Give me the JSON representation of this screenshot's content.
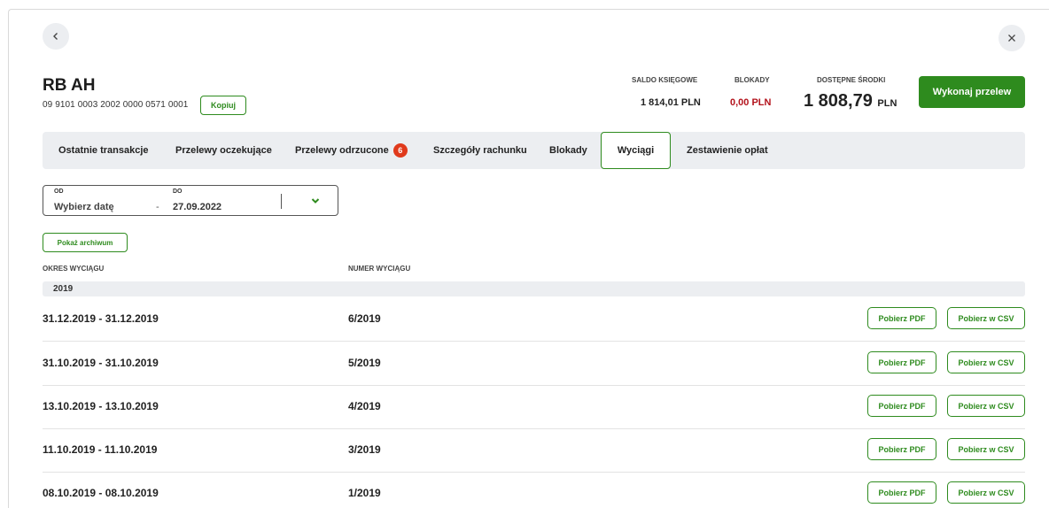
{
  "nav": {
    "back_icon": "chevron-left-icon",
    "close_icon": "close-icon"
  },
  "account": {
    "name": "RB AH",
    "number": "09 9101 0003 2002 0000 0571 0001",
    "copy_label": "Kopiuj"
  },
  "balances": {
    "saldo_label": "SALDO KSIĘGOWE",
    "saldo_value": "1 814,01 PLN",
    "blokady_label": "BLOKADY",
    "blokady_value": "0,00 PLN",
    "dostepne_label": "DOSTĘPNE ŚRODKI",
    "dostepne_value": "1 808,79",
    "dostepne_currency": "PLN"
  },
  "transfer_button": "Wykonaj przelew",
  "tabs": [
    {
      "label": "Ostatnie transakcje"
    },
    {
      "label": "Przelewy oczekujące"
    },
    {
      "label": "Przelewy odrzucone",
      "badge": "6"
    },
    {
      "label": "Szczegóły rachunku"
    },
    {
      "label": "Blokady"
    },
    {
      "label": "Wyciągi",
      "active": true
    },
    {
      "label": "Zestawienie opłat"
    }
  ],
  "date_filter": {
    "from_label": "OD",
    "from_placeholder": "Wybierz datę",
    "separator": "-",
    "to_label": "DO",
    "to_value": "27.09.2022"
  },
  "archive_button": "Pokaż archiwum",
  "table": {
    "col_period": "OKRES WYCIĄGU",
    "col_number": "NUMER WYCIĄGU",
    "year": "2019",
    "pdf_label": "Pobierz PDF",
    "csv_label": "Pobierz w CSV",
    "rows": [
      {
        "period": "31.12.2019 - 31.12.2019",
        "number": "6/2019"
      },
      {
        "period": "31.10.2019 - 31.10.2019",
        "number": "5/2019"
      },
      {
        "period": "13.10.2019 - 13.10.2019",
        "number": "4/2019"
      },
      {
        "period": "11.10.2019 - 11.10.2019",
        "number": "3/2019"
      },
      {
        "period": "08.10.2019 - 08.10.2019",
        "number": "1/2019"
      }
    ]
  },
  "colors": {
    "accent": "#2e8b1e",
    "danger": "#b3121b",
    "badge": "#e03a1c",
    "surface": "#eceef1"
  }
}
